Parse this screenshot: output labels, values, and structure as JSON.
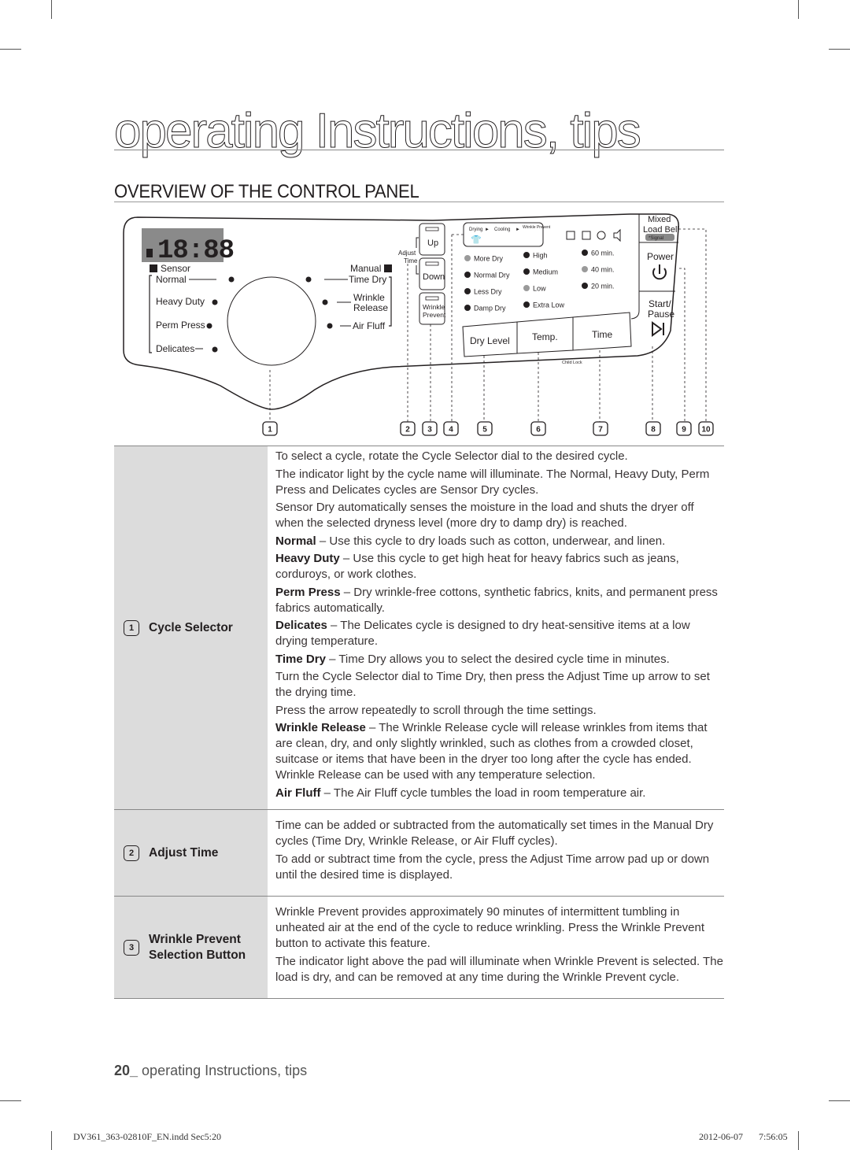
{
  "page": {
    "title": "operating Instructions, tips",
    "section_title": "OVERVIEW OF THE CONTROL PANEL"
  },
  "panel": {
    "display": "18:88",
    "sensor_label": "Sensor",
    "manual_label": "Manual",
    "sensor_cycles": [
      "Normal",
      "Heavy Duty",
      "Perm Press",
      "Delicates"
    ],
    "manual_cycles": [
      "Time Dry",
      "Wrinkle",
      "Release",
      "Air Fluff"
    ],
    "adjust_time_label_1": "Adjust",
    "adjust_time_label_2": "Time",
    "up_button": "Up",
    "down_button": "Down",
    "wrinkle_prevent_button_1": "Wrinkle",
    "wrinkle_prevent_button_2": "Prevent",
    "status_steps": [
      "Drying",
      "Cooling",
      "Wrinkle Prevent"
    ],
    "dry_levels": [
      {
        "label": "More Dry",
        "lit": false
      },
      {
        "label": "Normal Dry",
        "lit": true
      },
      {
        "label": "Less Dry",
        "lit": true
      },
      {
        "label": "Damp Dry",
        "lit": true
      }
    ],
    "temps": [
      {
        "label": "High",
        "lit": true
      },
      {
        "label": "Medium",
        "lit": true
      },
      {
        "label": "Low",
        "lit": false
      },
      {
        "label": "Extra Low",
        "lit": true
      }
    ],
    "times": [
      {
        "label": "60 min.",
        "lit": true
      },
      {
        "label": "40 min.",
        "lit": false
      },
      {
        "label": "20 min.",
        "lit": true
      }
    ],
    "dry_level_button": "Dry Level",
    "temp_button": "Temp.",
    "time_button": "Time",
    "child_lock": "Child Lock",
    "mixed_load_bell_1": "Mixed",
    "mixed_load_bell_2": "Load Bell",
    "signal_label": "*Signal",
    "power_button": "Power",
    "start_pause_1": "Start/",
    "start_pause_2": "Pause",
    "callouts": [
      "1",
      "2",
      "3",
      "4",
      "5",
      "6",
      "7",
      "8",
      "9",
      "10"
    ]
  },
  "table": [
    {
      "num": "1",
      "label": "Cycle Selector",
      "paragraphs": [
        {
          "bold": "",
          "text": "To select a cycle, rotate the Cycle Selector dial to the desired cycle."
        },
        {
          "bold": "",
          "text": "The indicator light by the cycle name will illuminate. The Normal, Heavy Duty, Perm Press and Delicates cycles are Sensor Dry cycles."
        },
        {
          "bold": "",
          "text": "Sensor Dry automatically senses the moisture in the load and shuts the dryer off when the selected dryness level (more dry to damp dry) is reached."
        },
        {
          "bold": "Normal",
          "text": " – Use this cycle to dry loads such as cotton, underwear, and linen."
        },
        {
          "bold": "Heavy Duty",
          "text": " – Use this cycle to get high heat for heavy fabrics such as jeans, corduroys, or work clothes."
        },
        {
          "bold": "Perm Press",
          "text": " – Dry wrinkle-free cottons, synthetic fabrics, knits, and permanent press fabrics automatically."
        },
        {
          "bold": "Delicates",
          "text": " – The Delicates cycle is designed to dry heat-sensitive items at a low drying temperature."
        },
        {
          "bold": "Time Dry",
          "text": " – Time Dry allows you to select the desired cycle time in minutes."
        },
        {
          "bold": "",
          "text": "Turn the Cycle Selector dial to Time Dry, then press the Adjust Time up arrow to set the drying time."
        },
        {
          "bold": "",
          "text": "Press the arrow repeatedly to scroll through the time settings."
        },
        {
          "bold": "Wrinkle Release",
          "text": " – The Wrinkle Release cycle will release wrinkles from items that are clean, dry, and only slightly wrinkled, such as clothes from a crowded closet, suitcase or items that have been in the dryer too long after the cycle has ended. Wrinkle Release can be used with any temperature selection."
        },
        {
          "bold": "Air Fluff",
          "text": " – The Air Fluff cycle tumbles the load in room temperature air."
        }
      ]
    },
    {
      "num": "2",
      "label": "Adjust Time",
      "paragraphs": [
        {
          "bold": "",
          "text": "Time can be added or subtracted from the automatically set times in the Manual Dry cycles (Time Dry, Wrinkle Release, or Air Fluff cycles)."
        },
        {
          "bold": "",
          "text": "To add or subtract time from the cycle, press the Adjust Time arrow pad up or down until the desired time is displayed."
        }
      ]
    },
    {
      "num": "3",
      "label": "Wrinkle Prevent Selection Button",
      "paragraphs": [
        {
          "bold": "",
          "text": "Wrinkle Prevent provides approximately 90 minutes of intermittent tumbling in unheated air at the end of the cycle to reduce wrinkling. Press the Wrinkle Prevent button to activate this feature."
        },
        {
          "bold": "",
          "text": "The indicator light above the pad will illuminate when Wrinkle Prevent is selected. The load is dry, and can be removed at any time during the Wrinkle Prevent cycle."
        }
      ]
    }
  ],
  "footer": {
    "page_number": "20_",
    "text": " operating Instructions, tips"
  },
  "slug": {
    "file": "DV361_363-02810F_EN.indd   Sec5:20",
    "date": "2012-06-07",
    "time": "7:56:05"
  },
  "colors": {
    "text": "#231f20",
    "table_label_bg": "#dcdcdc",
    "lcd_bg": "#8a8a8a",
    "led_on": "#231f20",
    "led_off": "#9a9a9a"
  }
}
